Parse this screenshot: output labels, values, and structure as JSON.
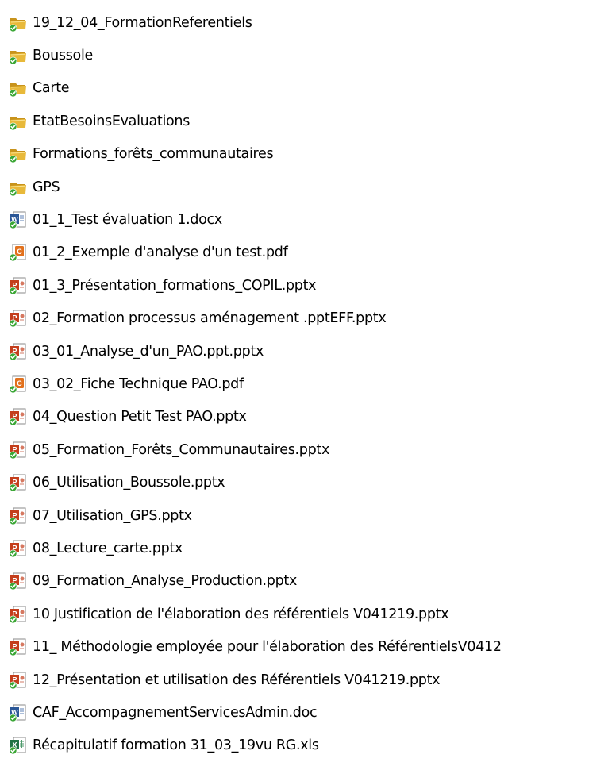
{
  "items": [
    {
      "name": "19_12_04_FormationReferentiels",
      "icon": "folder-icon"
    },
    {
      "name": "Boussole",
      "icon": "folder-icon"
    },
    {
      "name": "Carte",
      "icon": "folder-icon"
    },
    {
      "name": "EtatBesoinsEvaluations",
      "icon": "folder-icon"
    },
    {
      "name": "Formations_forêts_communautaires",
      "icon": "folder-icon"
    },
    {
      "name": "GPS",
      "icon": "folder-icon"
    },
    {
      "name": "01_1_Test évaluation 1.docx",
      "icon": "word-document-icon"
    },
    {
      "name": "01_2_Exemple d'analyse d'un test.pdf",
      "icon": "pdf-icon"
    },
    {
      "name": "01_3_Présentation_formations_COPIL.pptx",
      "icon": "powerpoint-icon"
    },
    {
      "name": "02_Formation processus aménagement .pptEFF.pptx",
      "icon": "powerpoint-icon"
    },
    {
      "name": "03_01_Analyse_d'un_PAO.ppt.pptx",
      "icon": "powerpoint-icon"
    },
    {
      "name": "03_02_Fiche Technique PAO.pdf",
      "icon": "pdf-icon"
    },
    {
      "name": "04_Question Petit Test PAO.pptx",
      "icon": "powerpoint-icon"
    },
    {
      "name": "05_Formation_Forêts_Communautaires.pptx",
      "icon": "powerpoint-icon"
    },
    {
      "name": "06_Utilisation_Boussole.pptx",
      "icon": "powerpoint-icon"
    },
    {
      "name": "07_Utilisation_GPS.pptx",
      "icon": "powerpoint-icon"
    },
    {
      "name": "08_Lecture_carte.pptx",
      "icon": "powerpoint-icon"
    },
    {
      "name": "09_Formation_Analyse_Production.pptx",
      "icon": "powerpoint-icon"
    },
    {
      "name": "10 Justification de l'élaboration des référentiels V041219.pptx",
      "icon": "powerpoint-icon"
    },
    {
      "name": "11_ Méthodologie employée pour l'élaboration des RéférentielsV0412",
      "icon": "powerpoint-icon"
    },
    {
      "name": "12_Présentation et utilisation des Référentiels V041219.pptx",
      "icon": "powerpoint-icon"
    },
    {
      "name": "CAF_AccompagnementServicesAdmin.doc",
      "icon": "word-document-icon"
    },
    {
      "name": "Récapitulatif formation 31_03_19vu RG.xls",
      "icon": "excel-icon"
    }
  ],
  "colors": {
    "folder": "#e8b93a",
    "folder_dark": "#c8931c",
    "sync_check": "#3aa635",
    "word": "#2b5797",
    "pdf": "#e2711d",
    "powerpoint": "#c43e1c",
    "excel": "#1f7244"
  }
}
